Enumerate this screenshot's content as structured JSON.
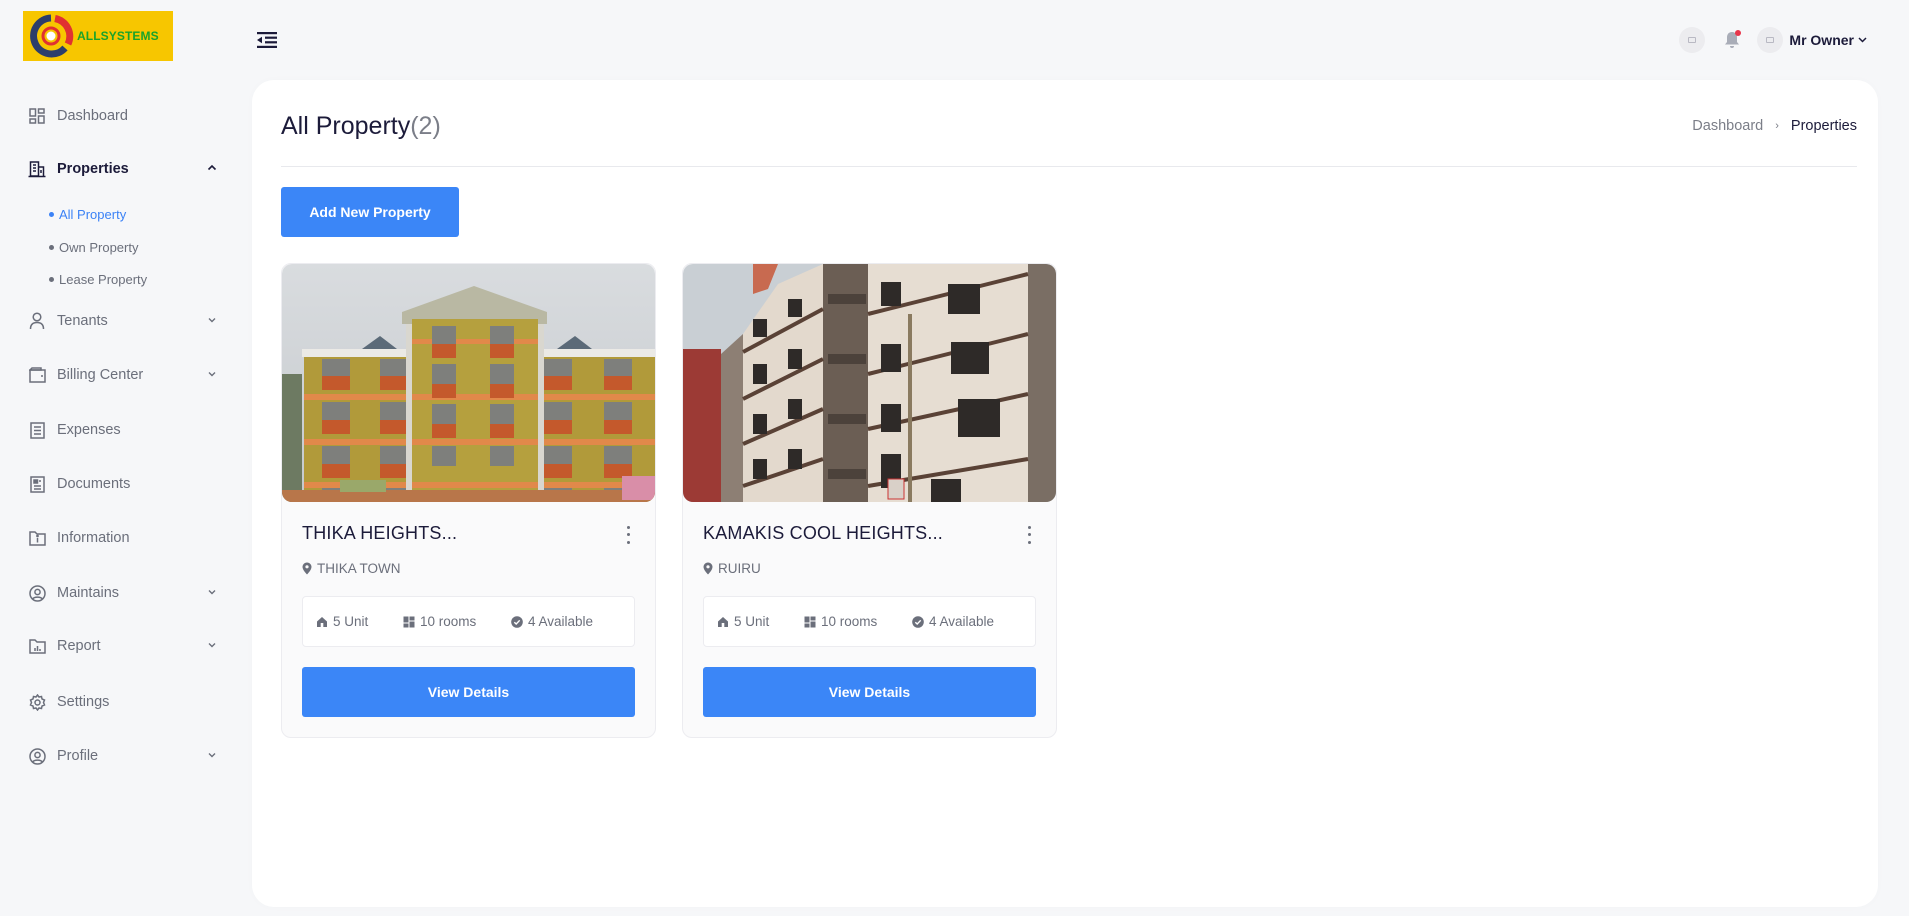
{
  "brand": {
    "name": "ALLSYSTEMS"
  },
  "topbar": {
    "user_name": "Mr Owner",
    "notification_badge": true
  },
  "sidebar": {
    "items": [
      {
        "label": "Dashboard",
        "icon": "dashboard-icon",
        "expandable": false
      },
      {
        "label": "Properties",
        "icon": "building-icon",
        "expandable": true,
        "expanded": true,
        "children": [
          {
            "label": "All Property",
            "active": true
          },
          {
            "label": "Own Property",
            "active": false
          },
          {
            "label": "Lease Property",
            "active": false
          }
        ]
      },
      {
        "label": "Tenants",
        "icon": "user-icon",
        "expandable": true
      },
      {
        "label": "Billing Center",
        "icon": "wallet-icon",
        "expandable": true
      },
      {
        "label": "Expenses",
        "icon": "receipt-icon",
        "expandable": false
      },
      {
        "label": "Documents",
        "icon": "document-icon",
        "expandable": false
      },
      {
        "label": "Information",
        "icon": "info-folder-icon",
        "expandable": false
      },
      {
        "label": "Maintains",
        "icon": "user-circle-icon",
        "expandable": true
      },
      {
        "label": "Report",
        "icon": "report-icon",
        "expandable": true
      },
      {
        "label": "Settings",
        "icon": "gear-icon",
        "expandable": false
      },
      {
        "label": "Profile",
        "icon": "profile-icon",
        "expandable": true
      }
    ]
  },
  "page": {
    "title": "All Property",
    "count": "(2)",
    "breadcrumb": {
      "parent": "Dashboard",
      "separator": "›",
      "current": "Properties"
    },
    "add_button": "Add New Property"
  },
  "properties": [
    {
      "name": "THIKA HEIGHTS...",
      "location": "THIKA TOWN",
      "units": "5 Unit",
      "rooms": "10 rooms",
      "available": "4 Available",
      "button": "View Details",
      "image": "orange-yellow apartment block"
    },
    {
      "name": "KAMAKIS COOL HEIGHTS...",
      "location": "RUIRU",
      "units": "5 Unit",
      "rooms": "10 rooms",
      "available": "4 Available",
      "button": "View Details",
      "image": "cream multi-storey apartment"
    }
  ],
  "colors": {
    "primary": "#3b86f7",
    "active_link": "#3b82f6",
    "badge": "#e8354a",
    "logo_bg": "#f7c600",
    "logo_text": "#1aa32a"
  }
}
